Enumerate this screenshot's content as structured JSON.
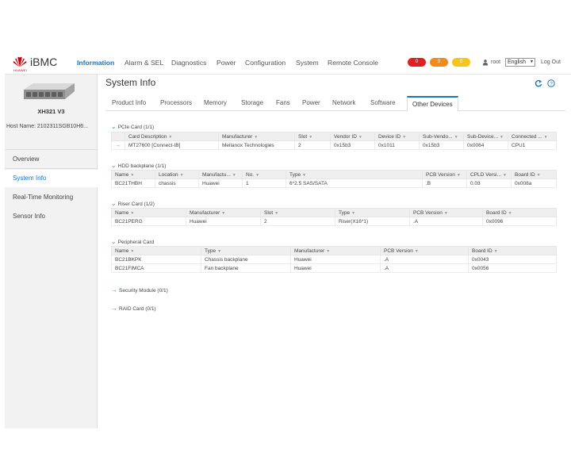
{
  "header": {
    "brand_small": "HUAWEI",
    "logo_text": "iBMC",
    "nav": [
      "Information",
      "Alarm & SEL",
      "Diagnostics",
      "Power",
      "Configuration",
      "System",
      "Remote Console"
    ],
    "alarms": [
      {
        "count": "0",
        "color": "#e02020"
      },
      {
        "count": "0",
        "color": "#f08a1c"
      },
      {
        "count": "0",
        "color": "#f5c518"
      }
    ],
    "user": "root",
    "language": "English",
    "logout": "Log Out"
  },
  "sidebar": {
    "server_model": "XH321 V3",
    "host_name": "Host Name: 2102311SGB10H6...",
    "items": [
      "Overview",
      "System Info",
      "Real-Time Monitoring",
      "Sensor Info"
    ]
  },
  "main": {
    "title": "System Info",
    "tabs": [
      "Product Info",
      "Processors",
      "Memory",
      "Storage",
      "Fans",
      "Power",
      "Network",
      "Software",
      "Other Devices"
    ],
    "pcie": {
      "title": "PCIe Card (1/1)",
      "headers": [
        "Card Description",
        "Manufacturer",
        "Slot",
        "Vendor ID",
        "Device ID",
        "Sub-Vendo...",
        "Sub-Device...",
        "Connected ..."
      ],
      "rows": [
        [
          "MT27600 [Connect-IB]",
          "Mellanox Technologies",
          "2",
          "0x15b3",
          "0x1011",
          "0x15b3",
          "0x0064",
          "CPU1"
        ]
      ]
    },
    "hdd": {
      "title": "HDD backplane (1/1)",
      "headers": [
        "Name",
        "Location",
        "Manufactu...",
        "No.",
        "Type",
        "PCB Version",
        "CPLD Versi...",
        "Board ID"
      ],
      "rows": [
        [
          "BC21THBH",
          "chassis",
          "Huawei",
          "1",
          "6*2.5 SAS/SATA",
          ".B",
          "0.03",
          "0x008a"
        ]
      ]
    },
    "riser": {
      "title": "Riser Card (1/2)",
      "headers": [
        "Name",
        "Manufacturer",
        "Slot",
        "Type",
        "PCB Version",
        "Board ID"
      ],
      "rows": [
        [
          "BC21PERG",
          "Huawei",
          "2",
          "Riser(X16*1)",
          ".A",
          "0x0096"
        ]
      ]
    },
    "peripheral": {
      "title": "Peripheral Card",
      "headers": [
        "Name",
        "Type",
        "Manufacturer",
        "PCB Version",
        "Board ID"
      ],
      "rows": [
        [
          "BC21BKPK",
          "Chassis backplane",
          "Huawei",
          ".A",
          "0x0043"
        ],
        [
          "BC21FIMCA",
          "Fan backplane",
          "Huawei",
          ".A",
          "0x0056"
        ]
      ]
    },
    "security": "Security Module (0/1)",
    "raid": "RAID Card (0/1)"
  }
}
